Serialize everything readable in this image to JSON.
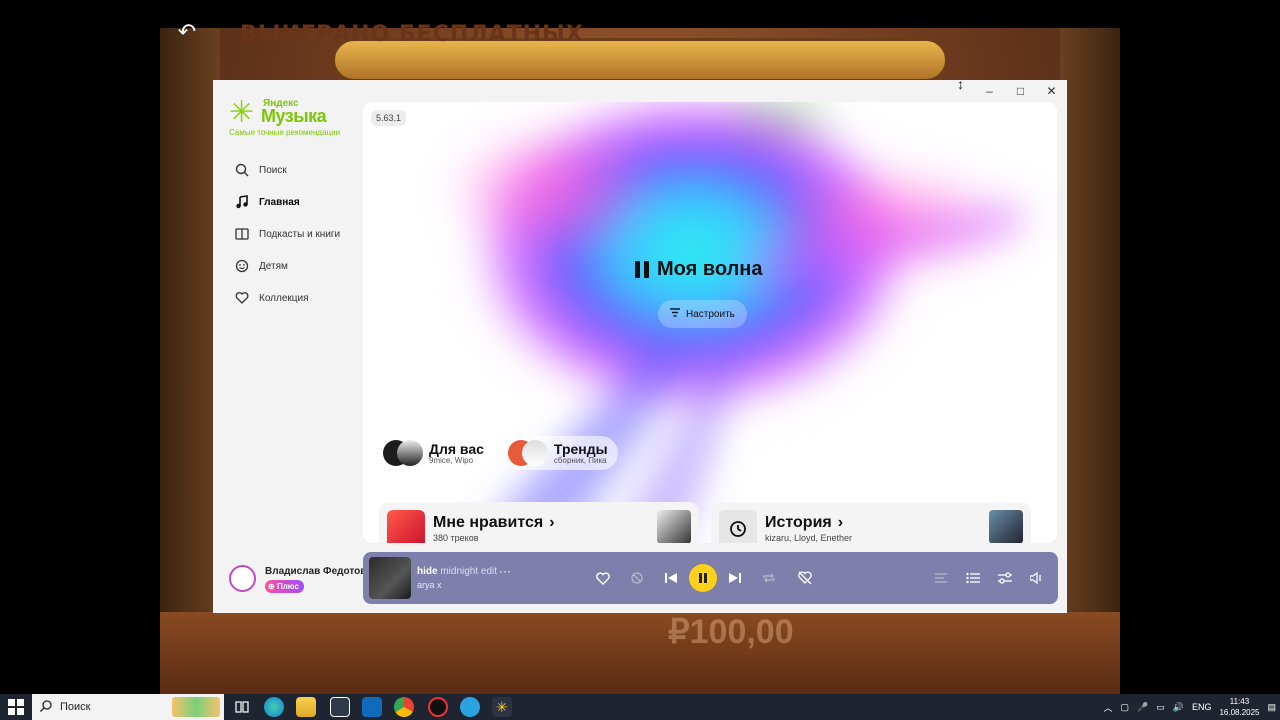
{
  "background": {
    "banner_text": "ВЫИГРАНО БЕСПЛАТНЫХ",
    "bottom_text": "₽100,00"
  },
  "window": {
    "controls": {
      "minimize": "–",
      "maximize": "□",
      "close": "✕"
    }
  },
  "logo": {
    "small": "Яндекс",
    "big": "Музыка",
    "tagline": "Самые точные рекомендации"
  },
  "sidebar": {
    "items": [
      {
        "label": "Поиск",
        "icon": "search-icon",
        "active": false
      },
      {
        "label": "Главная",
        "icon": "music-note-icon",
        "active": true
      },
      {
        "label": "Подкасты и книги",
        "icon": "book-icon",
        "active": false
      },
      {
        "label": "Детям",
        "icon": "kids-icon",
        "active": false
      },
      {
        "label": "Коллекция",
        "icon": "heart-icon",
        "active": false
      }
    ]
  },
  "user": {
    "name": "Владислав Федотов",
    "plus_label": "Плюс"
  },
  "main": {
    "version": "5.63.1",
    "wave_title": "Моя волна",
    "tune_label": "Настроить",
    "chips": [
      {
        "title": "Для вас",
        "subtitle": "9mice, Wipo"
      },
      {
        "title": "Тренды",
        "subtitle": "сборник, Пика"
      }
    ],
    "cards": [
      {
        "title": "Мне нравится",
        "subtitle": "380 треков"
      },
      {
        "title": "История",
        "subtitle": "kizaru, Lloyd, Enether"
      }
    ]
  },
  "player": {
    "track_title": "hide",
    "track_edit": "midnight edit",
    "artist": "arya x",
    "more": "···",
    "accent": "#ffd11a"
  },
  "taskbar": {
    "search_label": "Поиск",
    "lang": "ENG",
    "time": "11:43",
    "date": "16.08.2025"
  }
}
